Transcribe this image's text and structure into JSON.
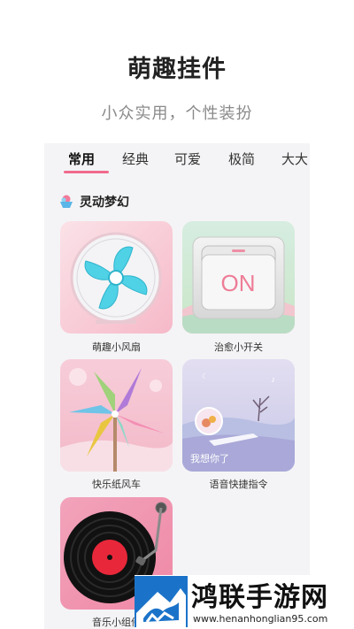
{
  "header": {
    "title": "萌趣挂件",
    "subtitle": "小众实用，个性装扮"
  },
  "tabs": [
    {
      "label": "常用",
      "active": true
    },
    {
      "label": "经典",
      "active": false
    },
    {
      "label": "可爱",
      "active": false
    },
    {
      "label": "极简",
      "active": false
    },
    {
      "label": "大大",
      "active": false
    }
  ],
  "section": {
    "title": "灵动梦幻",
    "icon": "ice-cream-icon"
  },
  "widgets": [
    {
      "label": "萌趣小风扇",
      "icon": "fan-icon"
    },
    {
      "label": "治愈小开关",
      "switch_text": "ON",
      "icon": "switch-icon"
    },
    {
      "label": "快乐纸风车",
      "icon": "pinwheel-icon"
    },
    {
      "label": "语音快捷指令",
      "overlay_text": "我想你了",
      "icon": "voice-scene-icon"
    },
    {
      "label": "音乐小组件",
      "icon": "vinyl-record-icon"
    }
  ],
  "watermark": {
    "title": "鸿联手游网",
    "url": "www.henanhonglian95.com",
    "icon": "horse-logo-icon"
  },
  "colors": {
    "accent": "#f06a8c",
    "fan_blue": "#4fd1e6",
    "record_red": "#e8283a"
  }
}
